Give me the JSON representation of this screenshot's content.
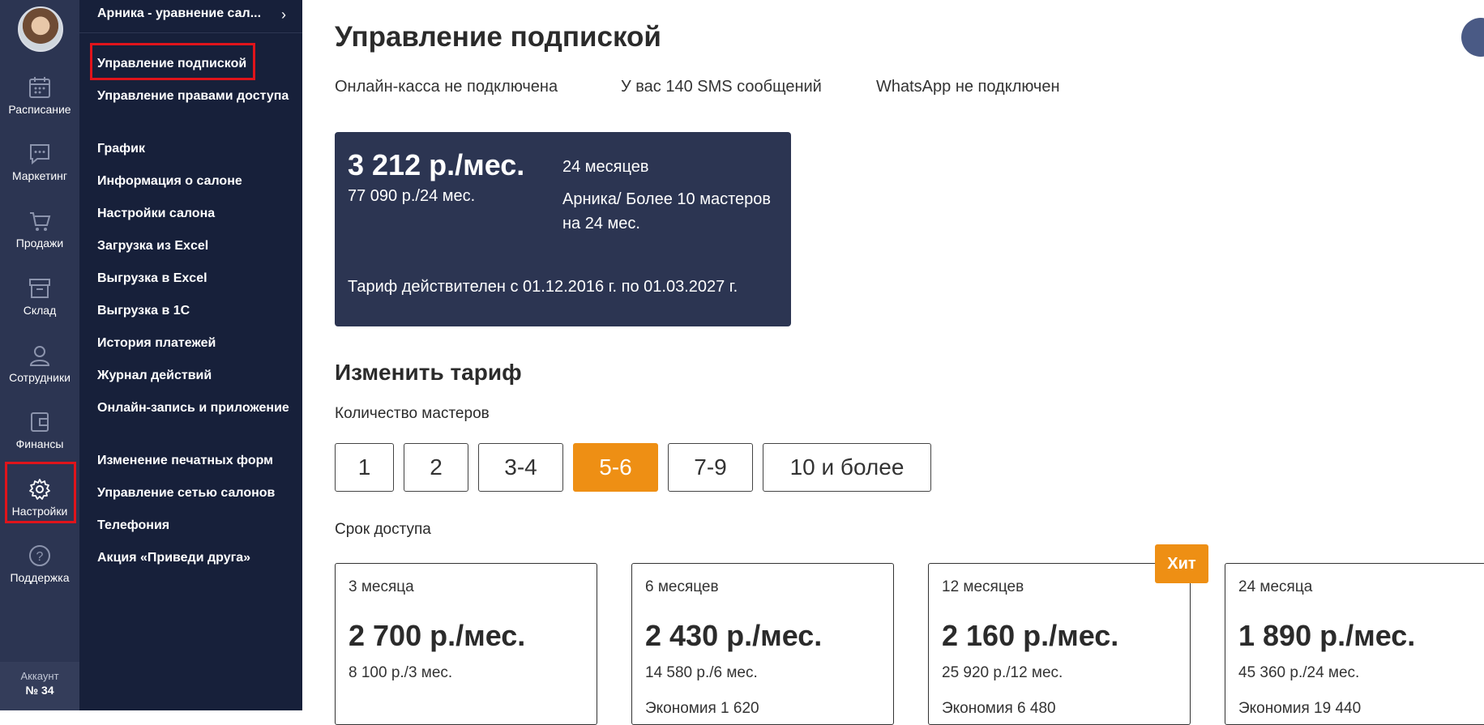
{
  "rail": {
    "items": [
      {
        "label": "Расписание",
        "icon": "calendar-icon"
      },
      {
        "label": "Маркетинг",
        "icon": "chat-icon"
      },
      {
        "label": "Продажи",
        "icon": "cart-icon"
      },
      {
        "label": "Склад",
        "icon": "box-icon"
      },
      {
        "label": "Сотрудники",
        "icon": "person-icon"
      },
      {
        "label": "Финансы",
        "icon": "wallet-icon"
      },
      {
        "label": "Настройки",
        "icon": "gear-icon"
      },
      {
        "label": "Поддержка",
        "icon": "help-icon"
      }
    ],
    "account_label": "Аккаунт",
    "account_number": "№ 34"
  },
  "menu": {
    "header": "Арника - уравнение сал...",
    "items": [
      "Управление подпиской",
      "Управление правами доступа",
      "График",
      "Информация о салоне",
      "Настройки салона",
      "Загрузка из Excel",
      "Выгрузка в Excel",
      "Выгрузка в 1С",
      "История платежей",
      "Журнал действий",
      "Онлайн-запись и приложение",
      "Изменение печатных форм",
      "Управление сетью салонов",
      "Телефония",
      "Акция «Приведи друга»"
    ]
  },
  "main": {
    "title": "Управление подпиской",
    "statuses": [
      "Онлайн-касса не подключена",
      "У вас 140 SMS сообщений",
      "WhatsApp не подключен"
    ],
    "current": {
      "price": "3 212 р./мес.",
      "total": "77 090 р./24 мес.",
      "months": "24 месяцев",
      "plan": "Арника/ Более 10 мастеров на 24 мес.",
      "valid": "Тариф действителен с 01.12.2016 г. по 01.03.2027 г."
    },
    "change_title": "Изменить тариф",
    "masters_label": "Количество мастеров",
    "masters_options": [
      "1",
      "2",
      "3-4",
      "5-6",
      "7-9",
      "10 и более"
    ],
    "masters_selected": "5-6",
    "term_label": "Срок доступа",
    "hit_label": "Хит",
    "plans": [
      {
        "name": "3 месяца",
        "price": "2 700 р./мес.",
        "total": "8 100 р./3 мес.",
        "saving": ""
      },
      {
        "name": "6 месяцев",
        "price": "2 430 р./мес.",
        "total": "14 580 р./6 мес.",
        "saving": "Экономия 1 620"
      },
      {
        "name": "12 месяцев",
        "price": "2 160 р./мес.",
        "total": "25 920 р./12 мес.",
        "saving": "Экономия 6 480"
      },
      {
        "name": "24 месяца",
        "price": "1 890 р./мес.",
        "total": "45 360 р./24 мес.",
        "saving": "Экономия 19 440"
      }
    ]
  },
  "colors": {
    "rail_bg": "#2c3552",
    "menu_bg": "#17203a",
    "accent": "#ee8f14",
    "highlight_box": "#e0141b"
  }
}
